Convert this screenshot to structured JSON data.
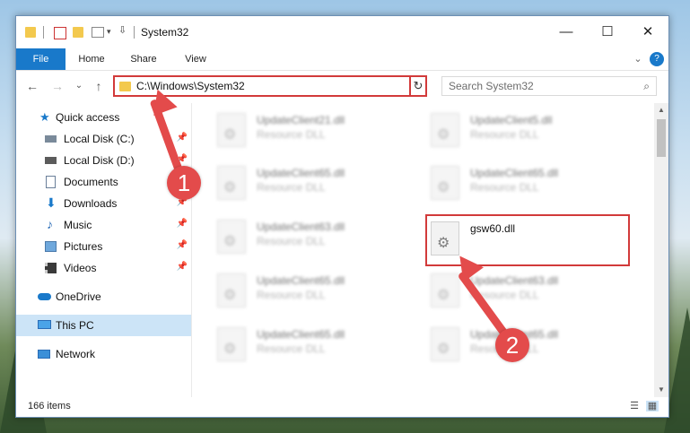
{
  "window": {
    "title": "System32",
    "controls": {
      "minimize": "—",
      "maximize": "☐",
      "close": "✕"
    }
  },
  "ribbon": {
    "tabs": [
      "File",
      "Home",
      "Share",
      "View"
    ],
    "help_icon": "?",
    "collapse_icon": "⌄"
  },
  "nav": {
    "back": "←",
    "forward": "→",
    "recent": "⌄",
    "up": "↑",
    "address": "C:\\Windows\\System32",
    "refresh": "↻",
    "search_placeholder": "Search System32",
    "search_icon": "⌕"
  },
  "sidebar": {
    "items": [
      {
        "label": "Quick access",
        "icon": "star-icon",
        "pinned": false
      },
      {
        "label": "Local Disk (C:)",
        "icon": "drive-icon",
        "pinned": true
      },
      {
        "label": "Local Disk (D:)",
        "icon": "drive-icon",
        "pinned": true
      },
      {
        "label": "Documents",
        "icon": "documents-icon",
        "pinned": true
      },
      {
        "label": "Downloads",
        "icon": "downloads-icon",
        "pinned": true
      },
      {
        "label": "Music",
        "icon": "music-icon",
        "pinned": true
      },
      {
        "label": "Pictures",
        "icon": "pictures-icon",
        "pinned": true
      },
      {
        "label": "Videos",
        "icon": "videos-icon",
        "pinned": true
      },
      {
        "label": "OneDrive",
        "icon": "cloud-icon",
        "pinned": false
      },
      {
        "label": "This PC",
        "icon": "computer-icon",
        "pinned": false,
        "selected": true
      },
      {
        "label": "Network",
        "icon": "network-icon",
        "pinned": false
      }
    ]
  },
  "files": [
    {
      "name": "UpdateClient21.dll",
      "type": "Resource DLL",
      "blurred": true
    },
    {
      "name": "UpdateClient5.dll",
      "type": "Resource DLL",
      "blurred": true
    },
    {
      "name": "UpdateClient65.dll",
      "type": "Resource DLL",
      "blurred": true
    },
    {
      "name": "UpdateClient65.dll",
      "type": "Resource DLL",
      "blurred": true
    },
    {
      "name": "UpdateClient63.dll",
      "type": "Resource DLL",
      "blurred": true
    },
    {
      "name": "gsw60.dll",
      "type": "",
      "blurred": false,
      "highlighted": true
    },
    {
      "name": "UpdateClient65.dll",
      "type": "Resource DLL",
      "blurred": true
    },
    {
      "name": "UpdateClient63.dll",
      "type": "Resource DLL",
      "blurred": true
    },
    {
      "name": "UpdateClient65.dll",
      "type": "Resource DLL",
      "blurred": true
    },
    {
      "name": "UpdateClient65.dll",
      "type": "Resource DLL",
      "blurred": true
    }
  ],
  "status": {
    "item_count": "166 items"
  },
  "annotations": {
    "step1": "1",
    "step2": "2",
    "color": "#e34b4b"
  },
  "colors": {
    "accent": "#1979ca",
    "selection": "#cce4f7",
    "highlight_box": "#d23a3a"
  }
}
